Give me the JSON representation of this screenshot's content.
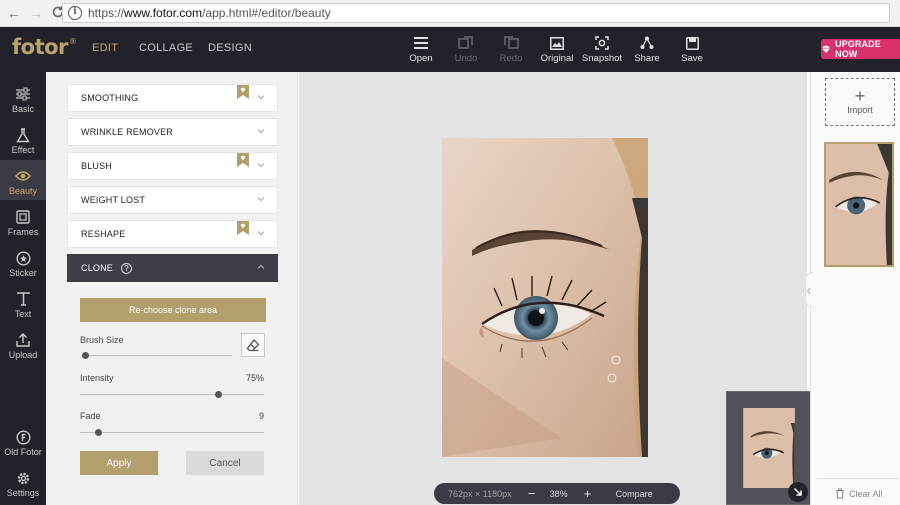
{
  "browser": {
    "url_prefix": "https://",
    "url_host": "www.fotor.com",
    "url_path": "/app.html#/editor/beauty"
  },
  "app": {
    "logo": "fotor",
    "logo_mark": "®",
    "nav": [
      "EDIT",
      "COLLAGE",
      "DESIGN"
    ],
    "active_nav": "EDIT",
    "tools": [
      {
        "label": "Open",
        "icon": "menu-icon"
      },
      {
        "label": "Undo",
        "icon": "undo-icon"
      },
      {
        "label": "Redo",
        "icon": "redo-icon"
      },
      {
        "label": "Original",
        "icon": "image-icon"
      },
      {
        "label": "Snapshot",
        "icon": "snapshot-icon"
      },
      {
        "label": "Share",
        "icon": "share-icon"
      },
      {
        "label": "Save",
        "icon": "save-icon"
      }
    ],
    "upgrade_label": "UPGRADE NOW"
  },
  "sidebar": {
    "items": [
      {
        "label": "Basic",
        "icon": "sliders-icon"
      },
      {
        "label": "Effect",
        "icon": "flask-icon"
      },
      {
        "label": "Beauty",
        "icon": "eye-icon"
      },
      {
        "label": "Frames",
        "icon": "frame-icon"
      },
      {
        "label": "Sticker",
        "icon": "sticker-icon"
      },
      {
        "label": "Text",
        "icon": "text-icon"
      },
      {
        "label": "Upload",
        "icon": "upload-icon"
      }
    ],
    "bottom_items": [
      {
        "label": "Old Fotor",
        "icon": "old-fotor-icon"
      },
      {
        "label": "Settings",
        "icon": "settings-icon"
      }
    ],
    "active": "Beauty"
  },
  "panel": {
    "accordion": [
      {
        "label": "SMOOTHING",
        "premium": true
      },
      {
        "label": "WRINKLE REMOVER",
        "premium": false
      },
      {
        "label": "BLUSH",
        "premium": true
      },
      {
        "label": "WEIGHT LOST",
        "premium": false
      },
      {
        "label": "RESHAPE",
        "premium": true
      }
    ],
    "clone": {
      "label": "CLONE",
      "help": "?",
      "rechoose_label": "Re-choose clone area",
      "brush_size_label": "Brush Size",
      "brush_size_level": 0.02,
      "intensity_label": "Intensity",
      "intensity_value": "75%",
      "intensity_level": 0.75,
      "fade_label": "Fade",
      "fade_value": "9",
      "fade_level": 0.1,
      "apply_label": "Apply",
      "cancel_label": "Cancel"
    }
  },
  "canvas": {
    "dimensions": "762px × 1180px",
    "zoom": "38%",
    "zoom_out": "−",
    "zoom_in": "+",
    "compare_label": "Compare"
  },
  "right_panel": {
    "import_label": "Import",
    "clear_all_label": "Clear All"
  },
  "colors": {
    "accent": "#b29f6b",
    "dark": "#22222b",
    "upgrade": "#d9306e"
  }
}
